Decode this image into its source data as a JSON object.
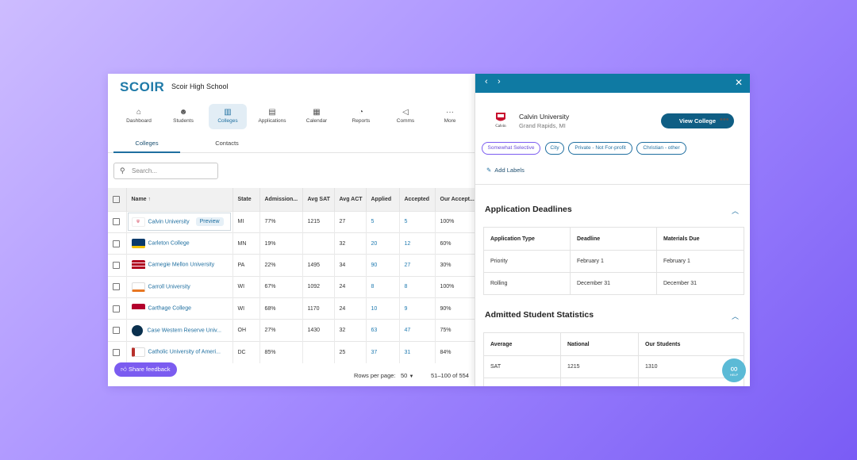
{
  "app": {
    "logo": "SCOIR",
    "school": "Scoir High School"
  },
  "nav": [
    {
      "label": "Dashboard",
      "icon": "home-icon",
      "glyph": "⌂"
    },
    {
      "label": "Students",
      "icon": "students-icon",
      "glyph": "☻"
    },
    {
      "label": "Colleges",
      "icon": "colleges-icon",
      "glyph": "▥",
      "active": true
    },
    {
      "label": "Applications",
      "icon": "applications-icon",
      "glyph": "▤"
    },
    {
      "label": "Calendar",
      "icon": "calendar-icon",
      "glyph": "▦"
    },
    {
      "label": "Reports",
      "icon": "reports-icon",
      "glyph": "◔"
    },
    {
      "label": "Comms",
      "icon": "megaphone-icon",
      "glyph": "◁"
    },
    {
      "label": "More",
      "icon": "more-icon",
      "glyph": "···"
    }
  ],
  "subtabs": [
    {
      "label": "Colleges",
      "active": true
    },
    {
      "label": "Contacts"
    }
  ],
  "search": {
    "placeholder": "Search..."
  },
  "table": {
    "columns": [
      "Name",
      "State",
      "Admission...",
      "Avg SAT",
      "Avg ACT",
      "Applied",
      "Accepted",
      "Our Accept..."
    ],
    "rows": [
      {
        "name": "Calvin University",
        "state": "MI",
        "admission": "77%",
        "sat": "1215",
        "act": "27",
        "applied": "5",
        "accepted": "5",
        "our": "100%",
        "preview": "Preview",
        "logo_color": "#c8102e"
      },
      {
        "name": "Carleton College",
        "state": "MN",
        "admission": "19%",
        "sat": "",
        "act": "32",
        "applied": "20",
        "accepted": "12",
        "our": "60%",
        "logo_color": "#0a3a6b"
      },
      {
        "name": "Carnegie Mellon University",
        "state": "PA",
        "admission": "22%",
        "sat": "1495",
        "act": "34",
        "applied": "90",
        "accepted": "27",
        "our": "30%",
        "logo_color": "#b00020"
      },
      {
        "name": "Carroll University",
        "state": "WI",
        "admission": "67%",
        "sat": "1092",
        "act": "24",
        "applied": "8",
        "accepted": "8",
        "our": "100%",
        "logo_color": "#e87722"
      },
      {
        "name": "Carthage College",
        "state": "WI",
        "admission": "68%",
        "sat": "1170",
        "act": "24",
        "applied": "10",
        "accepted": "9",
        "our": "90%",
        "logo_color": "#b3002d"
      },
      {
        "name": "Case Western Reserve Univ...",
        "state": "OH",
        "admission": "27%",
        "sat": "1430",
        "act": "32",
        "applied": "63",
        "accepted": "47",
        "our": "75%",
        "logo_color": "#0a304e"
      },
      {
        "name": "Catholic University of Ameri...",
        "state": "DC",
        "admission": "85%",
        "sat": "",
        "act": "25",
        "applied": "37",
        "accepted": "31",
        "our": "84%",
        "logo_color": "#b7312c"
      }
    ]
  },
  "footer": {
    "share": "Share feedback",
    "rows_per_page_label": "Rows per page:",
    "rows_per_page": "50",
    "range": "51–100 of 554"
  },
  "panel": {
    "college": "Calvin University",
    "location": "Grand Rapids, MI",
    "logo_text": "Calvin",
    "view_button": "View College",
    "chips": [
      "Somewhat Selective",
      "City",
      "Private - Not For-profit",
      "Christian - other"
    ],
    "add_labels": "Add Labels",
    "deadlines": {
      "title": "Application Deadlines",
      "columns": [
        "Application Type",
        "Deadline",
        "Materials Due"
      ],
      "rows": [
        [
          "Priority",
          "February 1",
          "February 1"
        ],
        [
          "Rolling",
          "December 31",
          "December 31"
        ]
      ]
    },
    "stats": {
      "title": "Admitted Student Statistics",
      "columns": [
        "Average",
        "National",
        "Our Students"
      ],
      "rows": [
        [
          "SAT",
          "1215",
          "1310"
        ]
      ]
    },
    "help_label": "HELP"
  },
  "colors": {
    "primary": "#0f7aa3",
    "accent": "#7b5cf0",
    "link": "#1f7ab0"
  }
}
